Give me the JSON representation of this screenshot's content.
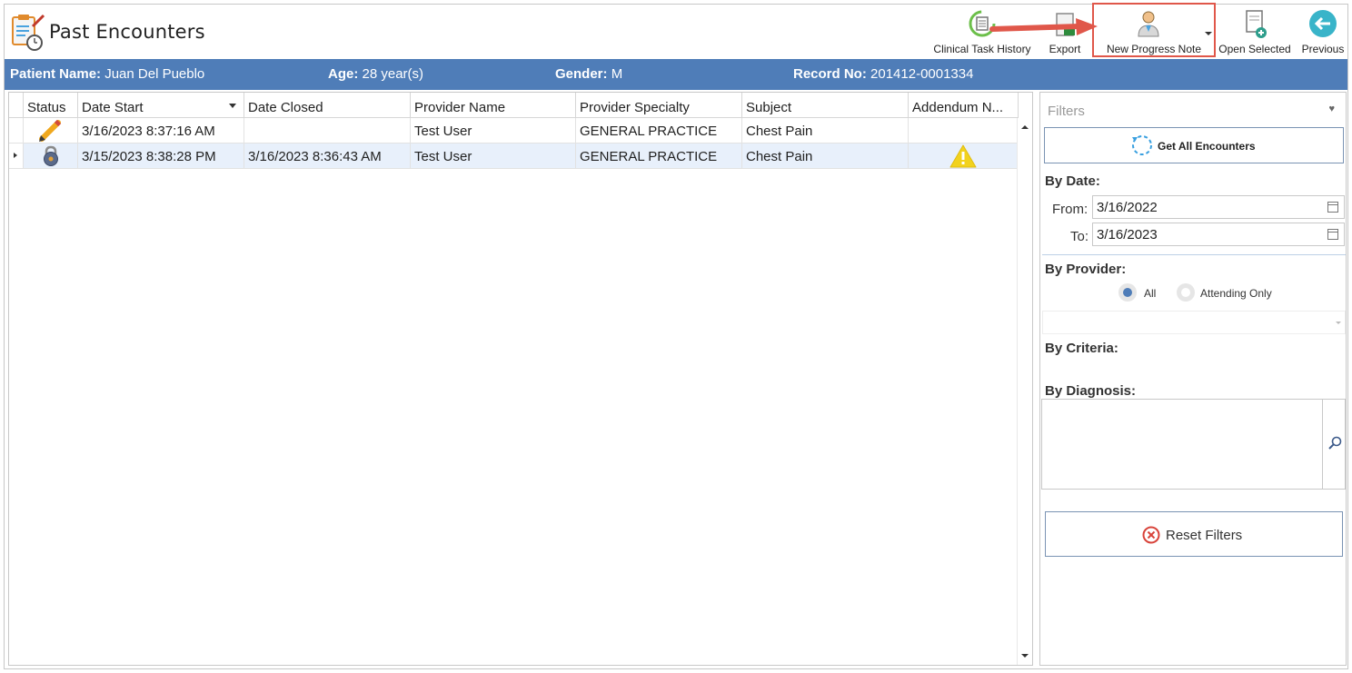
{
  "header": {
    "title": "Past Encounters",
    "toolbar": {
      "clinical_task_history": "Clinical Task History",
      "export": "Export",
      "new_progress_note": "New Progress Note",
      "open_selected": "Open Selected",
      "previous": "Previous"
    }
  },
  "patient": {
    "name_label": "Patient Name:",
    "name": "Juan Del Pueblo",
    "age_label": "Age:",
    "age": "28 year(s)",
    "gender_label": "Gender:",
    "gender": "M",
    "record_label": "Record No:",
    "record": "201412-0001334"
  },
  "grid": {
    "columns": [
      "Status",
      "Date Start",
      "Date Closed",
      "Provider Name",
      "Provider Specialty",
      "Subject",
      "Addendum N..."
    ],
    "rows": [
      {
        "status_icon": "pencil-icon",
        "date_start": "3/16/2023 8:37:16 AM",
        "date_closed": "",
        "provider": "Test User",
        "specialty": "GENERAL PRACTICE",
        "subject": "Chest Pain",
        "addendum_icon": ""
      },
      {
        "status_icon": "lock-icon",
        "date_start": "3/15/2023 8:38:28 PM",
        "date_closed": "3/16/2023 8:36:43 AM",
        "provider": "Test User",
        "specialty": "GENERAL PRACTICE",
        "subject": "Chest Pain",
        "addendum_icon": "warning-icon"
      }
    ]
  },
  "filters": {
    "title": "Filters",
    "get_all": "Get All Encounters",
    "by_date": "By Date:",
    "from_label": "From:",
    "from_value": "3/16/2022",
    "to_label": "To:",
    "to_value": "3/16/2023",
    "by_provider": "By Provider:",
    "radio_all": "All",
    "radio_attending": "Attending Only",
    "by_criteria": "By Criteria:",
    "by_diagnosis": "By Diagnosis:",
    "reset": "Reset Filters"
  },
  "colors": {
    "accent": "#4f7db8",
    "highlight_box": "#e0574a",
    "selected_row": "#e8f0fb",
    "warning": "#f2d21e"
  }
}
